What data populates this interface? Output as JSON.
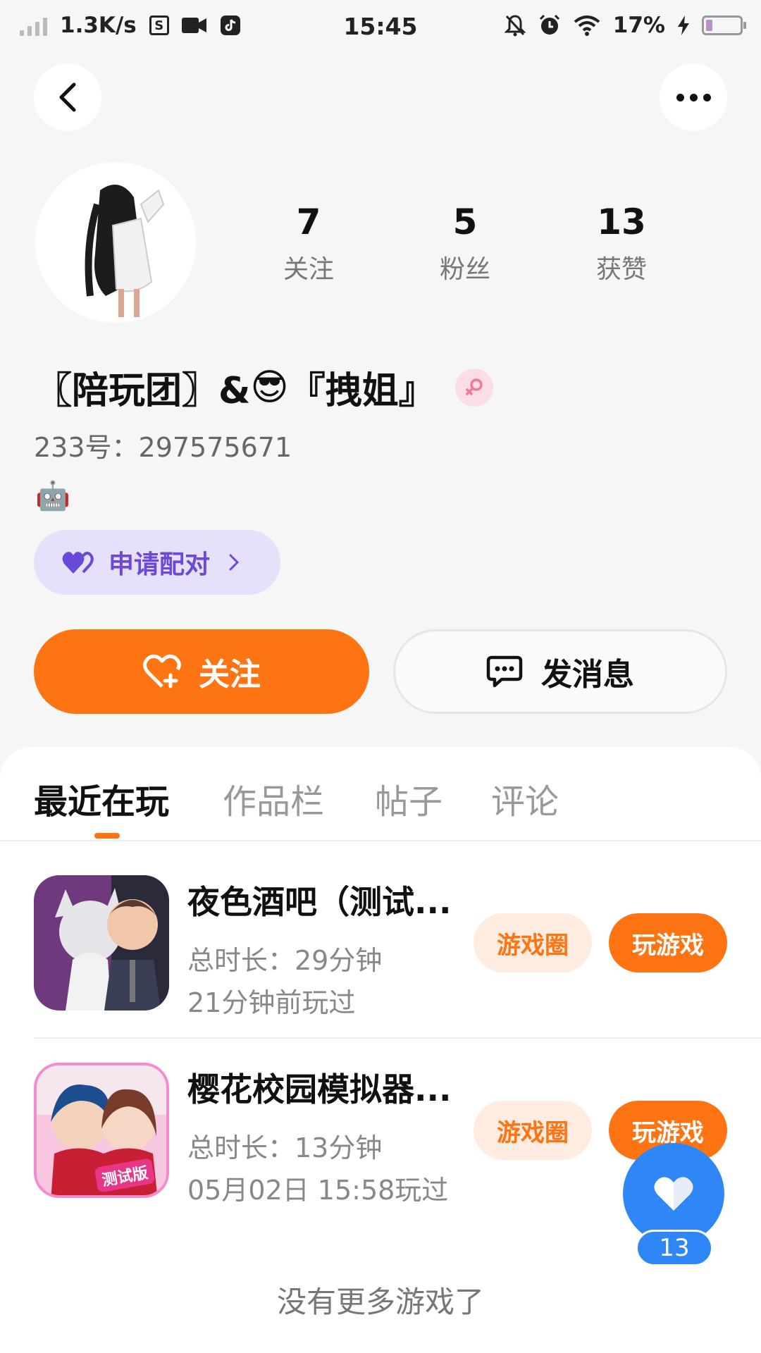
{
  "status_bar": {
    "speed": "1.3K/s",
    "s_icon": "S",
    "time": "15:45",
    "battery": "17%",
    "battery_level": 0.17
  },
  "profile": {
    "stats": [
      {
        "value": "7",
        "label": "关注"
      },
      {
        "value": "5",
        "label": "粉丝"
      },
      {
        "value": "13",
        "label": "获赞"
      }
    ],
    "nickname_prefix": "〖陪玩团〗&",
    "nickname_emoji": "😎",
    "nickname_suffix": "『拽姐』",
    "gender": "female",
    "user_id": "233号：297575671",
    "signature_emoji": "🤖",
    "pair_label": "申请配对"
  },
  "actions": {
    "follow_label": "关注",
    "message_label": "发消息"
  },
  "tabs": [
    "最近在玩",
    "作品栏",
    "帖子",
    "评论"
  ],
  "active_tab": 0,
  "games": [
    {
      "title": "夜色酒吧（测试...",
      "duration": "总时长：29分钟",
      "last_played": "21分钟前玩过",
      "circle_label": "游戏圈",
      "play_label": "玩游戏"
    },
    {
      "title": "樱花校园模拟器...",
      "duration": "总时长：13分钟",
      "last_played": "05月02日 15:58玩过",
      "circle_label": "游戏圈",
      "play_label": "玩游戏",
      "icon_badge": "测试版"
    }
  ],
  "no_more_text": "没有更多游戏了",
  "like_fab": {
    "count": "13"
  },
  "colors": {
    "accent": "#ff7412",
    "pair_purple": "#6b49d8",
    "fab_blue": "#2f86f6"
  }
}
